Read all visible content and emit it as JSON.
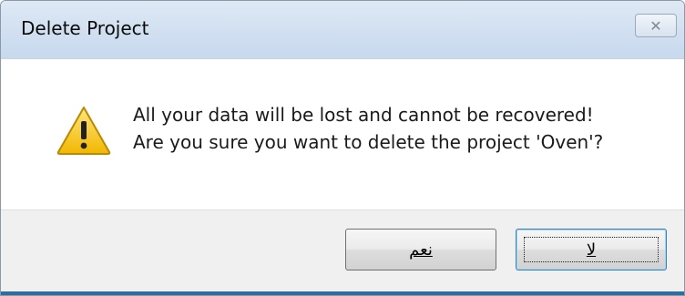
{
  "window": {
    "title": "Delete Project",
    "close_glyph": "✕"
  },
  "message": {
    "line1": "All your data will be lost and cannot be recovered!",
    "line2": "Are you sure you want to delete the project 'Oven'?"
  },
  "buttons": {
    "yes_label": "نعم",
    "no_label": "لا"
  },
  "icon": {
    "name": "warning-icon"
  },
  "colors": {
    "title_bar": "#d3e1f1",
    "footer": "#f0f0f0",
    "warning": "#f2c200"
  }
}
